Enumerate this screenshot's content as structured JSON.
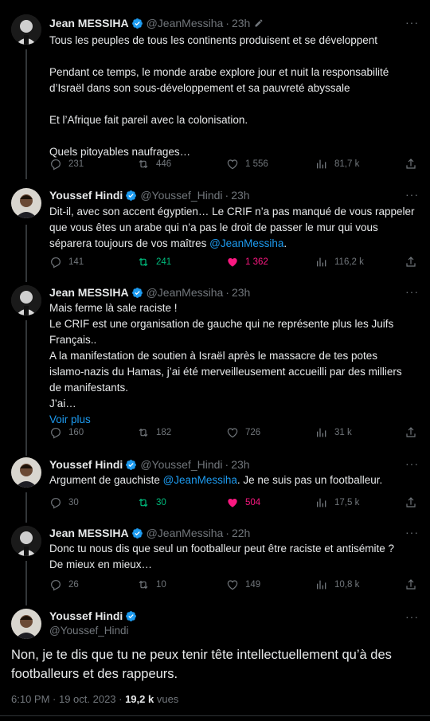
{
  "tweets": [
    {
      "name": "Jean MESSIHA",
      "handle": "@JeanMessiha",
      "time": "23h",
      "lines": [
        "Tous les peuples de tous les continents produisent et se développent",
        "",
        "Pendant ce temps, le monde arabe explore jour et nuit la responsabilité",
        "d’Israël dans son sous-développement et sa pauvreté abyssale",
        "",
        "Et l’Afrique fait pareil avec la colonisation.",
        "",
        "Quels pitoyables naufrages…"
      ],
      "replies": "231",
      "retweets": "446",
      "likes": "1 556",
      "views": "81,7 k"
    },
    {
      "name": "Youssef Hindi",
      "handle": "@Youssef_Hindi",
      "time": "23h",
      "line1": "Dit-il, avec son accent égyptien… Le CRIF n’a pas manqué de vous rappeler",
      "line2": "que vous êtes un arabe qui n’a pas le droit de passer le mur qui vous",
      "line3_pre": "séparera toujours de vos maîtres ",
      "mention": "@JeanMessiha",
      "line3_post": ".",
      "replies": "141",
      "retweets": "241",
      "likes": "1 362",
      "views": "116,2 k"
    },
    {
      "name": "Jean MESSIHA",
      "handle": "@JeanMessiha",
      "time": "23h",
      "lines": [
        "Mais ferme là sale raciste !",
        "Le CRIF est une organisation de gauche qui ne représente plus les Juifs",
        "Français..",
        "A la manifestation de soutien à Israël après le massacre de tes potes",
        "islamo-nazis du Hamas, j’ai été merveilleusement accueilli par des milliers",
        "de manifestants.",
        "J’ai…"
      ],
      "more_link": "Voir plus",
      "replies": "160",
      "retweets": "182",
      "likes": "726",
      "views": "31 k"
    },
    {
      "name": "Youssef Hindi",
      "handle": "@Youssef_Hindi",
      "time": "23h",
      "pre": "Argument de gauchiste ",
      "mention": "@JeanMessiha",
      "post": ". Je ne suis pas un footballeur.",
      "replies": "30",
      "retweets": "30",
      "likes": "504",
      "views": "17,5 k"
    },
    {
      "name": "Jean MESSIHA",
      "handle": "@JeanMessiha",
      "time": "22h",
      "lines": [
        "Donc tu nous dis que seul un footballeur peut être raciste et antisémite ?",
        "De mieux en mieux…"
      ],
      "replies": "26",
      "retweets": "10",
      "likes": "149",
      "views": "10,8 k"
    }
  ],
  "main": {
    "name": "Youssef Hindi",
    "handle": "@Youssef_Hindi",
    "line1": "Non, je te dis que tu ne peux tenir tête intellectuellement qu’à des",
    "line2": "footballeurs et des rappeurs.",
    "timestamp": "6:10 PM · 19 oct. 2023 · ",
    "views_count": "19,2 k",
    "views_label": " vues"
  },
  "colors": {
    "background": "#000000",
    "text": "#e7e9ea",
    "secondary": "#71767b",
    "link": "#1d9bf0",
    "retweet_active": "#00ba7c",
    "like_active": "#f91880",
    "verified": "#1d9bf0"
  },
  "icons": [
    "verified-badge-icon",
    "edit-pencil-icon",
    "more-dots-icon",
    "reply-icon",
    "retweet-icon",
    "like-icon",
    "views-icon",
    "share-icon"
  ]
}
